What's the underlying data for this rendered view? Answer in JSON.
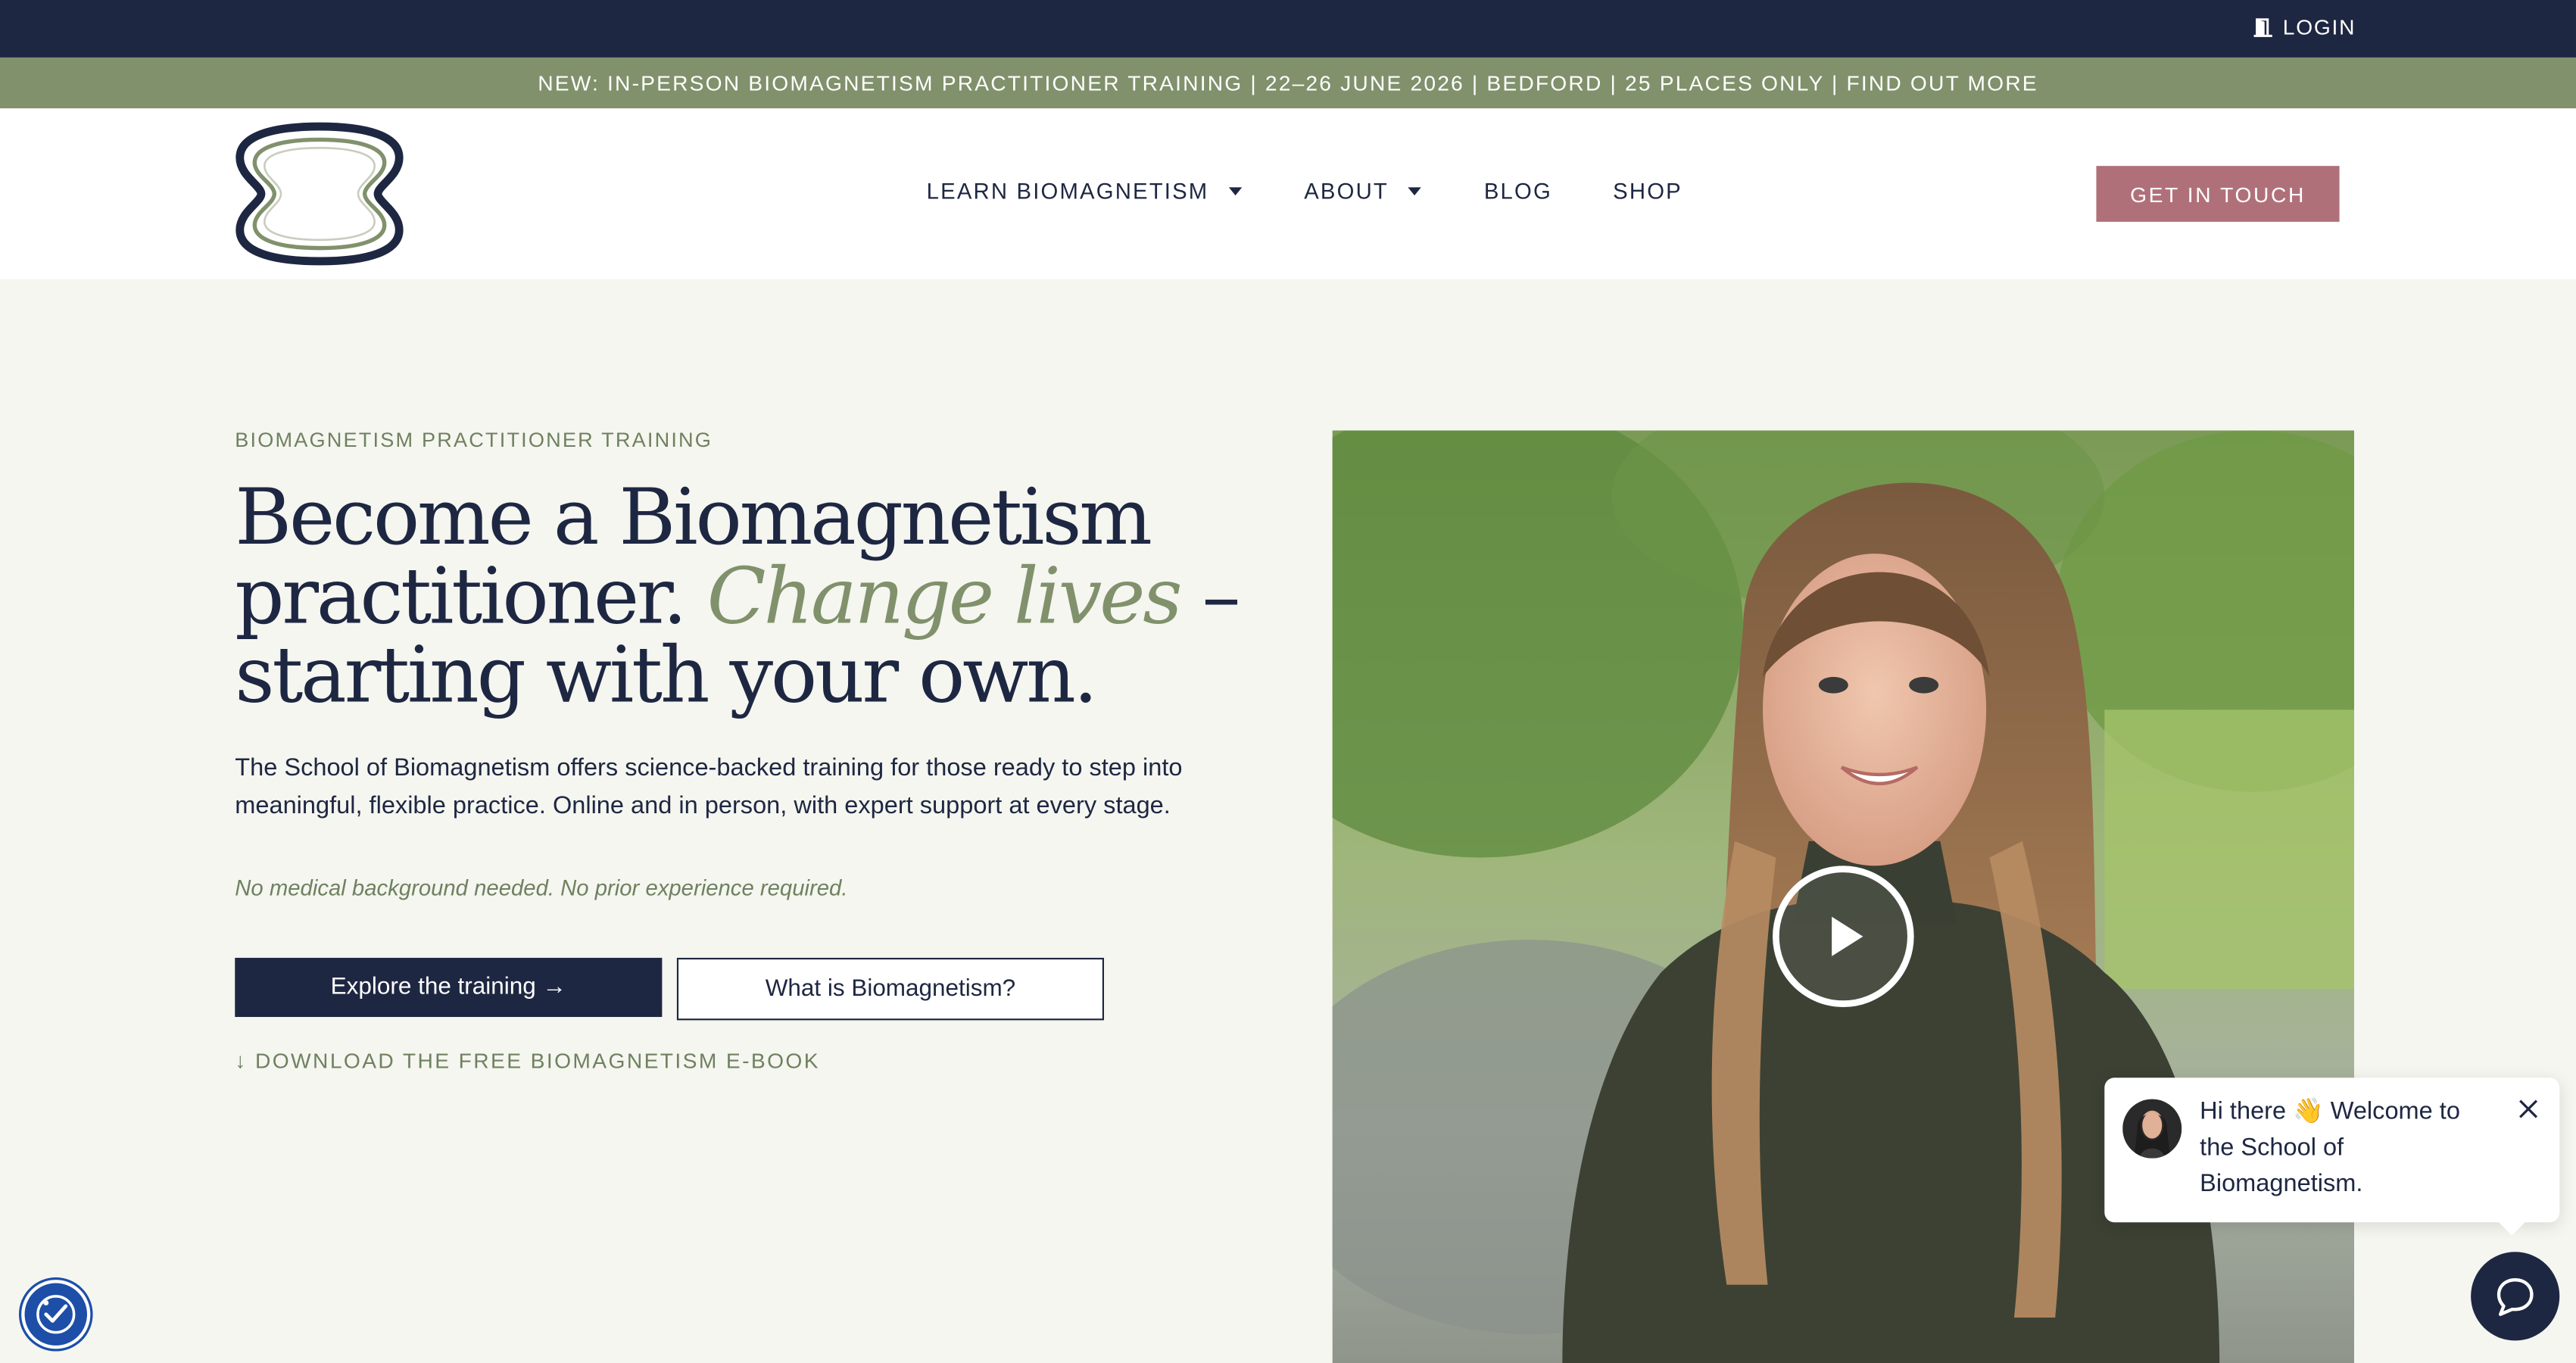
{
  "topbar": {
    "login_label": "LOGIN",
    "icon": "login-door-icon"
  },
  "announcement": {
    "text": "NEW: IN-PERSON BIOMAGNETISM PRACTITIONER TRAINING | 22–26 JUNE 2026 | BEDFORD | 25 PLACES ONLY | FIND OUT MORE"
  },
  "header": {
    "logo_icon": "school-logo-icon",
    "nav": [
      {
        "label": "LEARN BIOMAGNETISM",
        "has_dropdown": true
      },
      {
        "label": "ABOUT",
        "has_dropdown": true
      },
      {
        "label": "BLOG",
        "has_dropdown": false
      },
      {
        "label": "SHOP",
        "has_dropdown": false
      }
    ],
    "cta_label": "GET IN TOUCH"
  },
  "hero": {
    "eyebrow": "BIOMAGNETISM PRACTITIONER TRAINING",
    "headline_part1": "Become a Biomagnetism practitioner. ",
    "headline_accent": "Change lives",
    "headline_part2": " – starting with your own.",
    "lede": "The School of Biomagnetism offers science-backed training for those ready to step into meaningful, flexible practice. Online and in person, with expert support at every stage.",
    "note": "No medical background needed. No prior experience required.",
    "primary_button": "Explore the training →",
    "secondary_button": "What is Biomagnetism?",
    "download_link": "↓ DOWNLOAD THE FREE BIOMAGNETISM E-BOOK",
    "video_icon": "play-icon"
  },
  "chat": {
    "greeting": "Hi there 👋 Welcome to the School of Biomagnetism.",
    "close_icon": "close-icon",
    "launcher_icon": "chat-bubble-icon"
  },
  "accessibility": {
    "icon": "accessibility-icon"
  },
  "colors": {
    "navy": "#1e2742",
    "sage": "#80916c",
    "rose": "#b0707a",
    "background": "#f5f6f0"
  }
}
